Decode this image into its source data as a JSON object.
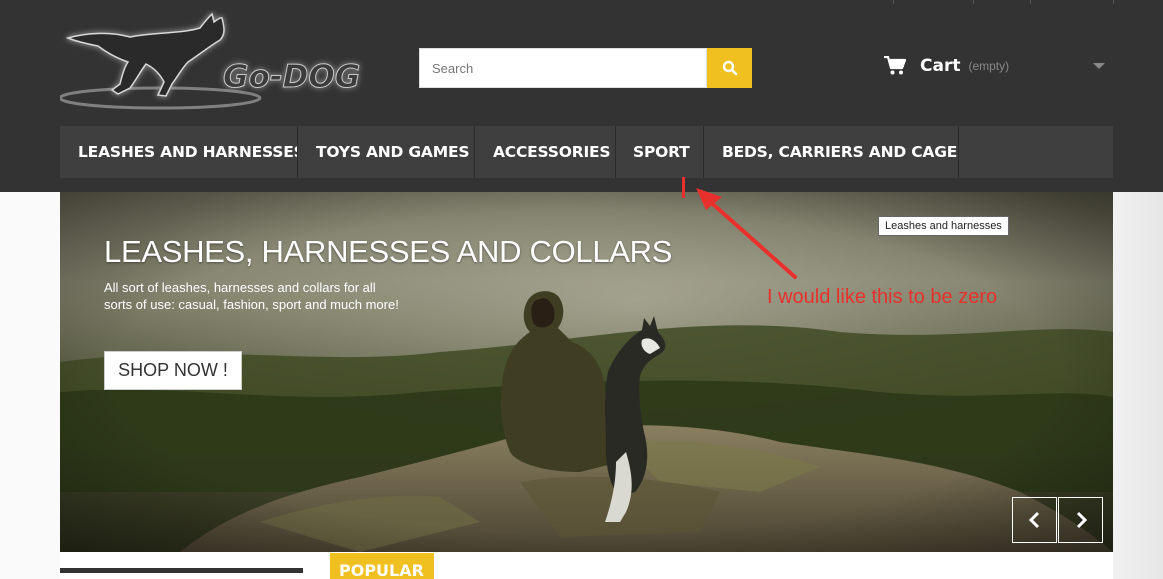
{
  "logo": {
    "text": "Go-DOG"
  },
  "search": {
    "placeholder": "Search",
    "button_icon": "search-icon"
  },
  "cart": {
    "label": "Cart",
    "status": "(empty)",
    "icon": "cart-icon"
  },
  "nav": {
    "items": [
      {
        "label": "LEASHES AND HARNESSES"
      },
      {
        "label": "TOYS AND GAMES"
      },
      {
        "label": "ACCESSORIES"
      },
      {
        "label": "SPORT"
      },
      {
        "label": "BEDS, CARRIERS AND CAGES"
      }
    ]
  },
  "hero": {
    "title": "LEASHES, HARNESSES AND COLLARS",
    "text": "All sort of leashes, harnesses and collars for all sorts of use: casual, fashion, sport and much more!",
    "button": "SHOP NOW !",
    "tooltip": "Leashes and harnesses"
  },
  "annotation": {
    "text": "I would like this to be zero",
    "color": "#e8312c"
  },
  "popular": {
    "label": "POPULAR"
  },
  "colors": {
    "header": "#333333",
    "nav": "#3f3f3f",
    "accent": "#f0c020",
    "annotation": "#e8312c"
  }
}
